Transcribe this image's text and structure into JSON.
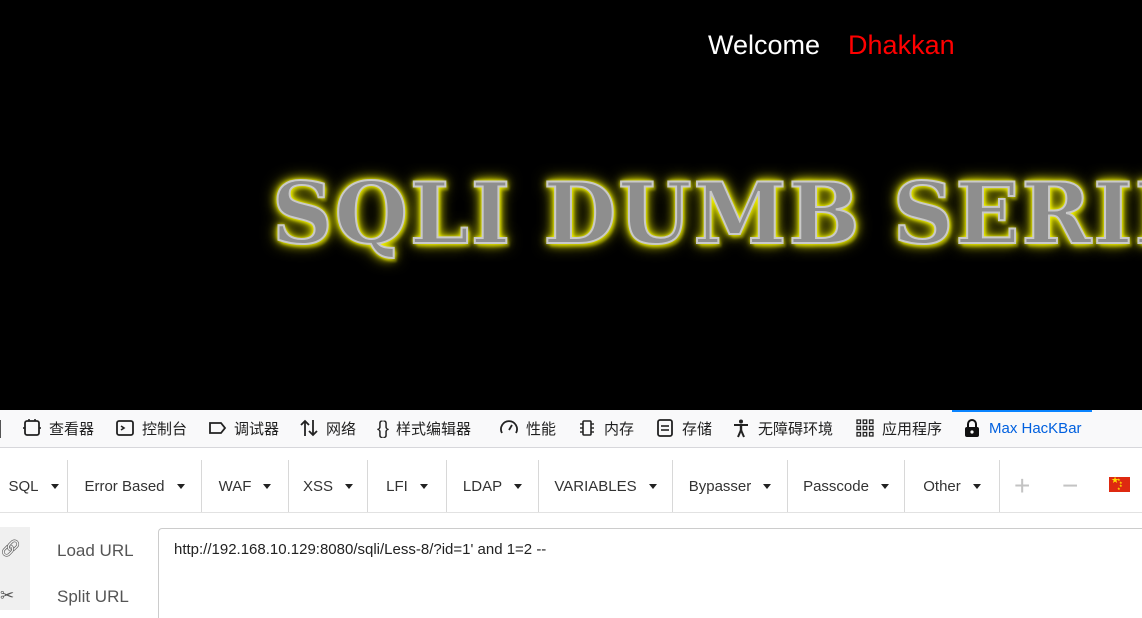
{
  "page": {
    "welcome_label": "Welcome",
    "username": "Dhakkan",
    "banner_text": "SQLI DUMB SERIES",
    "colors": {
      "background": "#000000",
      "username": "#ff0000",
      "banner_glow": "#ffff00"
    }
  },
  "devtools": {
    "tabs": [
      {
        "label": "查看器",
        "icon": "inspector-icon"
      },
      {
        "label": "控制台",
        "icon": "console-icon"
      },
      {
        "label": "调试器",
        "icon": "debugger-icon"
      },
      {
        "label": "网络",
        "icon": "network-icon"
      },
      {
        "label": "样式编辑器",
        "icon": "style-editor-icon"
      },
      {
        "label": "性能",
        "icon": "performance-icon"
      },
      {
        "label": "内存",
        "icon": "memory-icon"
      },
      {
        "label": "存储",
        "icon": "storage-icon"
      },
      {
        "label": "无障碍环境",
        "icon": "accessibility-icon"
      },
      {
        "label": "应用程序",
        "icon": "application-icon"
      },
      {
        "label": "Max HacKBar",
        "icon": "lock-icon",
        "active": true
      }
    ],
    "accent_color": "#0a84ff"
  },
  "hackbar": {
    "menu": [
      "SQL",
      "Error Based",
      "WAF",
      "XSS",
      "LFI",
      "LDAP",
      "VARIABLES",
      "Bypasser",
      "Passcode",
      "Other"
    ],
    "zoom_in_symbol": "+",
    "zoom_out_symbol": "−",
    "language_flag": "china-flag-icon",
    "actions": {
      "load_url": "Load URL",
      "split_url": "Split URL"
    },
    "url_value": "http://192.168.10.129:8080/sqli/Less-8/?id=1' and 1=2 --"
  }
}
